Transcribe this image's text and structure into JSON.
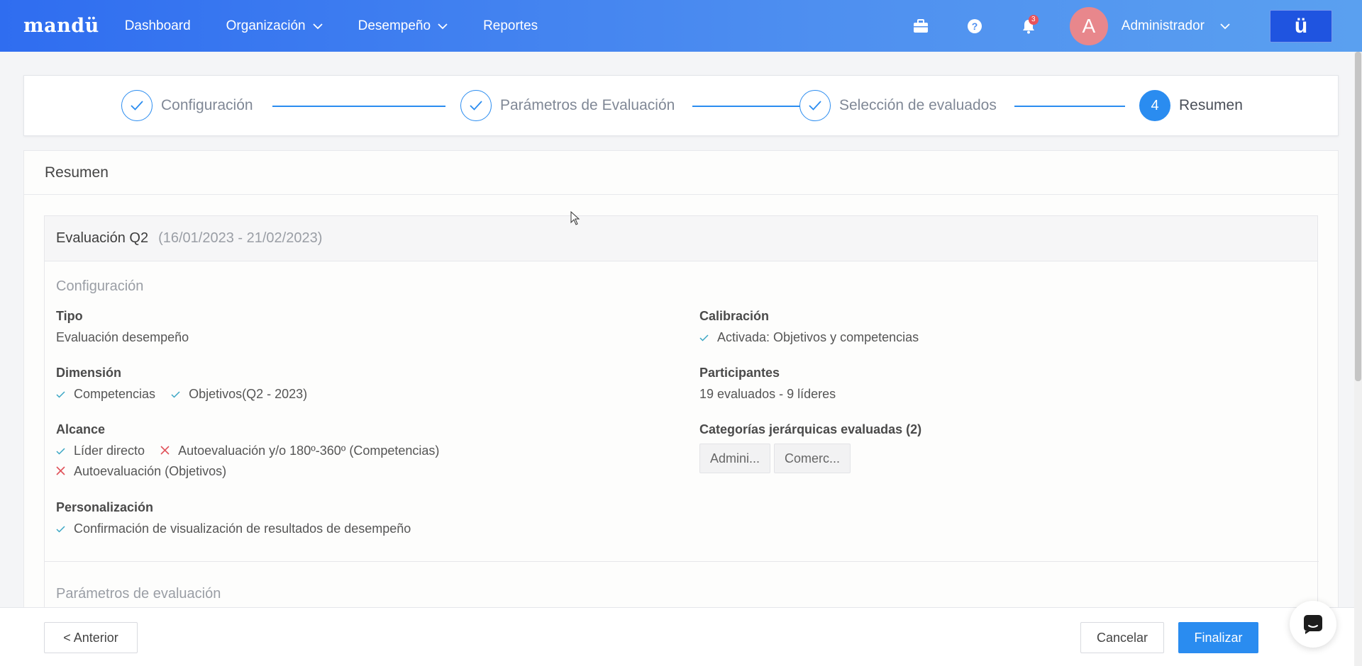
{
  "navbar": {
    "logo": "mandü",
    "links": [
      "Dashboard",
      "Organización",
      "Desempeño",
      "Reportes"
    ],
    "notification_count": "3",
    "avatar_initial": "A",
    "user_name": "Administrador",
    "brand_mark": "ü"
  },
  "stepper": {
    "steps": [
      {
        "label": "Configuración",
        "status": "done"
      },
      {
        "label": "Parámetros de Evaluación",
        "status": "done"
      },
      {
        "label": "Selección de evaluados",
        "status": "done"
      },
      {
        "label": "Resumen",
        "status": "active",
        "number": "4"
      }
    ]
  },
  "card": {
    "title": "Resumen",
    "evaluation": {
      "name": "Evaluación Q2",
      "dates": "(16/01/2023 - 21/02/2023)"
    },
    "configuracion": {
      "section_title": "Configuración",
      "tipo": {
        "label": "Tipo",
        "value": "Evaluación desempeño"
      },
      "dimension": {
        "label": "Dimensión",
        "items": [
          "Competencias",
          "Objetivos(Q2 - 2023)"
        ]
      },
      "alcance": {
        "label": "Alcance",
        "items": [
          {
            "text": "Líder directo",
            "enabled": true
          },
          {
            "text": "Autoevaluación y/o 180º-360º (Competencias)",
            "enabled": false
          },
          {
            "text": "Autoevaluación (Objetivos)",
            "enabled": false
          }
        ]
      },
      "personalizacion": {
        "label": "Personalización",
        "items": [
          "Confirmación de visualización de resultados de desempeño"
        ]
      },
      "calibracion": {
        "label": "Calibración",
        "items": [
          "Activada: Objetivos y competencias"
        ]
      },
      "participantes": {
        "label": "Participantes",
        "value": "19 evaluados - 9 líderes"
      },
      "categorias": {
        "label": "Categorías jerárquicas evaluadas (2)",
        "tags": [
          "Admini...",
          "Comerc..."
        ]
      }
    },
    "parametros": {
      "section_title": "Parámetros de evaluación"
    }
  },
  "footer": {
    "prev_label": "< Anterior",
    "cancel_label": "Cancelar",
    "finish_label": "Finalizar"
  },
  "colors": {
    "primary": "#2a8cf0",
    "check": "#3aa6c4",
    "cross": "#e0525a"
  }
}
